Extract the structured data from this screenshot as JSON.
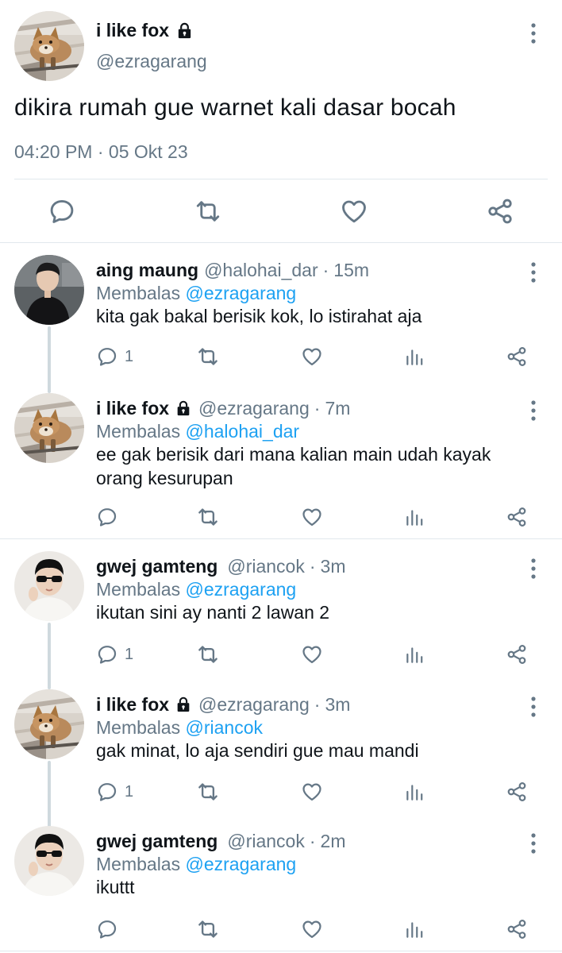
{
  "colors": {
    "text": "#0f1419",
    "secondary": "#657786",
    "link": "#1da1f2",
    "icon": "#657786",
    "border": "#e1e8ed"
  },
  "main_tweet": {
    "name": "i like fox",
    "handle": "@ezragarang",
    "text": "dikira rumah gue warnet kali dasar bocah",
    "time": "04:20 PM",
    "separator": "·",
    "date": "05 Okt 23",
    "avatar_icon": "fox-avatar",
    "lock_icon": "lock-icon"
  },
  "replies": [
    {
      "name": "aing maung",
      "handle": "@halohai_dar",
      "separator": "·",
      "time": "15m",
      "replying_label": "Membalas",
      "replying_to": "@ezragarang",
      "text": "kita gak bakal berisik kok, lo istirahat aja",
      "reply_count": "1",
      "protected": false,
      "avatar_icon": "person-avatar-dark"
    },
    {
      "name": "i like fox",
      "handle": "@ezragarang",
      "separator": "·",
      "time": "7m",
      "replying_label": "Membalas",
      "replying_to": "@halohai_dar",
      "text": "ee gak berisik dari mana kalian main udah kayak orang kesurupan",
      "reply_count": "",
      "protected": true,
      "avatar_icon": "fox-avatar"
    },
    {
      "name": "gwej gamteng",
      "handle": "@riancok",
      "separator": "·",
      "time": "3m",
      "replying_label": "Membalas",
      "replying_to": "@ezragarang",
      "text": "ikutan sini ay nanti 2 lawan 2",
      "reply_count": "1",
      "protected": false,
      "avatar_icon": "person-sunglasses-avatar"
    },
    {
      "name": "i like fox",
      "handle": "@ezragarang",
      "separator": "·",
      "time": "3m",
      "replying_label": "Membalas",
      "replying_to": "@riancok",
      "text": "gak minat, lo aja sendiri gue mau mandi",
      "reply_count": "1",
      "protected": true,
      "avatar_icon": "fox-avatar"
    },
    {
      "name": "gwej gamteng",
      "handle": "@riancok",
      "separator": "·",
      "time": "2m",
      "replying_label": "Membalas",
      "replying_to": "@ezragarang",
      "text": "ikuttt",
      "reply_count": "",
      "protected": false,
      "avatar_icon": "person-sunglasses-avatar"
    }
  ]
}
